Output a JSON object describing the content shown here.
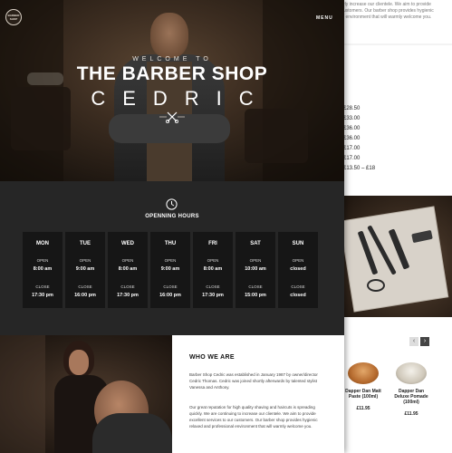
{
  "back_page": {
    "intro_lines": [
      "rly increase our clientele. We aim to provide",
      "ustomers. Our barber shop provides hygienic",
      "l environment that will warmly welcome you."
    ],
    "prices": [
      "£28.50",
      "£33.00",
      "£36.00",
      "£36.00",
      "£17.00",
      "£17.00",
      "£13.50 – £18"
    ],
    "shop": {
      "products": [
        {
          "name": "Dapper Dan Matt Paste (100ml)",
          "price": "£11.95"
        },
        {
          "name": "Dapper Dan Deluxe Pomade (100ml)",
          "price": "£11.95"
        }
      ],
      "prev_symbol": "‹",
      "next_symbol": "›"
    }
  },
  "header": {
    "logo_lines": [
      "BARBER",
      "SHOP"
    ],
    "menu_label": "MENU"
  },
  "hero": {
    "welcome": "WELCOME TO",
    "title": "THE BARBER SHOP",
    "subtitle": "CEDRIC"
  },
  "hours": {
    "title": "OPENNING HOURS",
    "open_label": "OPEN",
    "close_label": "CLOSE",
    "days": [
      {
        "name": "MON",
        "open": "8:00 am",
        "close": "17:30 pm"
      },
      {
        "name": "TUE",
        "open": "9:00 am",
        "close": "16:00 pm"
      },
      {
        "name": "WED",
        "open": "8:00 am",
        "close": "17:30 pm"
      },
      {
        "name": "THU",
        "open": "9:00 am",
        "close": "16:00 pm"
      },
      {
        "name": "FRI",
        "open": "8:00 am",
        "close": "17:30 pm"
      },
      {
        "name": "SAT",
        "open": "10:00 am",
        "close": "15:00 pm"
      },
      {
        "name": "SUN",
        "open": "closed",
        "close": "closed"
      }
    ]
  },
  "about": {
    "title": "WHO WE ARE",
    "paragraph1": "Barber Shop Cedric was established in January 1987 by owner/director Cedric Thomas. Cedric was joined shortly afterwards by talented stylist Vanessa and Anthony.",
    "paragraph2": "Our great reputation for high quality shaving and haircuts is spreading quickly. We are continuing to increase our clientele. We aim to provide excellent services to our customers. Our barber shop provides hygienic relaxed and professional environment that will warmly welcome you."
  },
  "colors": {
    "dark_bg": "#1f1f1f",
    "card_bg": "#161616",
    "accent_white": "#ffffff"
  },
  "icons": [
    "scissors-icon",
    "clock-icon",
    "chevron-left-icon",
    "chevron-right-icon"
  ]
}
